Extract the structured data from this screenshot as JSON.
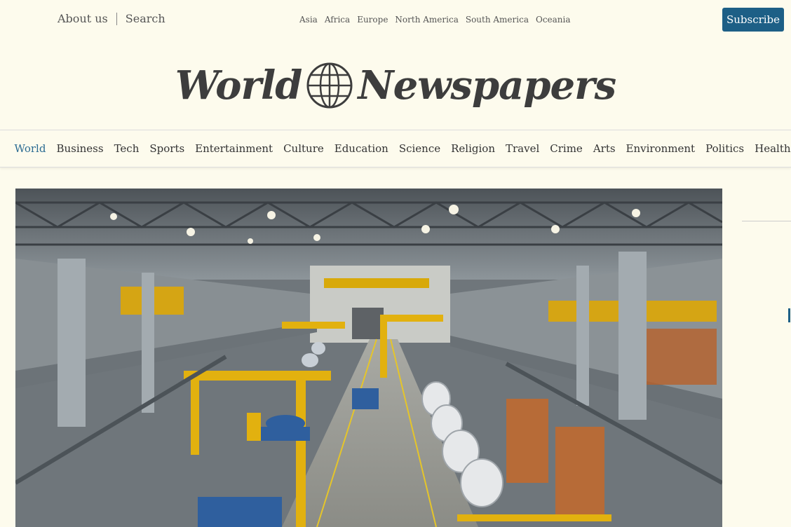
{
  "top_links": {
    "about": "About us",
    "search": "Search"
  },
  "regions": [
    "Asia",
    "Africa",
    "Europe",
    "North America",
    "South America",
    "Oceania"
  ],
  "subscribe_label": "Subscribe",
  "masthead": {
    "word1": "World",
    "word2": "Newspapers"
  },
  "nav": [
    {
      "label": "World",
      "active": true
    },
    {
      "label": "Business"
    },
    {
      "label": "Tech"
    },
    {
      "label": "Sports"
    },
    {
      "label": "Entertainment"
    },
    {
      "label": "Culture"
    },
    {
      "label": "Education"
    },
    {
      "label": "Science"
    },
    {
      "label": "Religion"
    },
    {
      "label": "Travel"
    },
    {
      "label": "Crime"
    },
    {
      "label": "Arts"
    },
    {
      "label": "Environment"
    },
    {
      "label": "Politics"
    },
    {
      "label": "Health"
    }
  ],
  "colors": {
    "accent": "#1d5f86",
    "background": "#fdfbed",
    "active_nav": "#2b6b92"
  }
}
